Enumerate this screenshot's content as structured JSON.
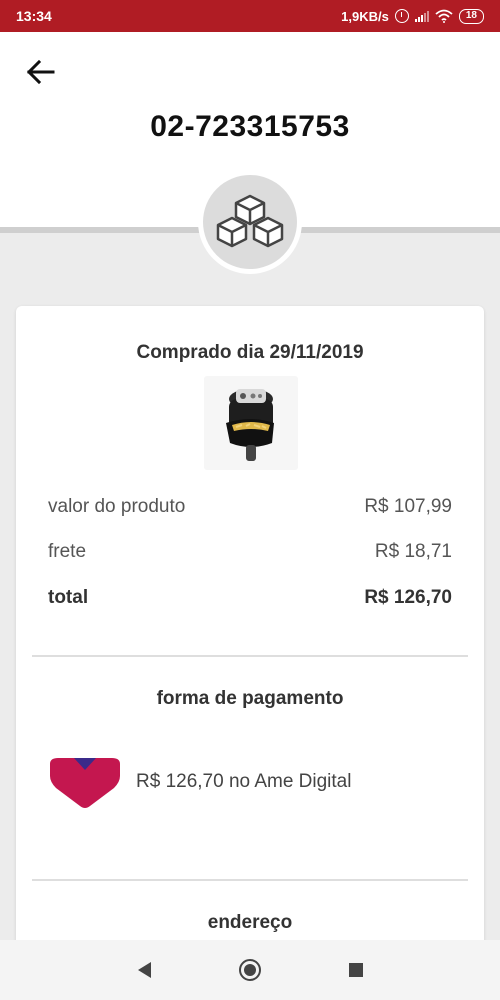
{
  "status_bar": {
    "time": "13:34",
    "network_speed": "1,9KB/s",
    "battery": "18",
    "icons": [
      "alarm-icon",
      "signal-icon",
      "wifi-icon",
      "battery-icon"
    ]
  },
  "header": {
    "order_id": "02-723315753",
    "back_icon": "arrow-left-icon",
    "badge_icon": "boxes-icon"
  },
  "order": {
    "purchase_date": "Comprado dia 29/11/2019",
    "product_image": "air-fryer-product-image",
    "rows": [
      {
        "label": "valor do produto",
        "value": "R$ 107,99"
      },
      {
        "label": "frete",
        "value": "R$ 18,71"
      },
      {
        "label": "total",
        "value": "R$ 126,70"
      }
    ]
  },
  "payment": {
    "title": "forma de pagamento",
    "method_text": "R$ 126,70 no Ame Digital",
    "logo": "ame-digital-logo"
  },
  "address": {
    "title": "endereço"
  },
  "nav": {
    "items": [
      "nav-back-icon",
      "nav-home-icon",
      "nav-recent-icon"
    ]
  },
  "colors": {
    "status_bar": "#b01c24",
    "background": "#ececec",
    "ame_logo": "#c4174f",
    "ame_logo_accent": "#3b2a8a"
  }
}
